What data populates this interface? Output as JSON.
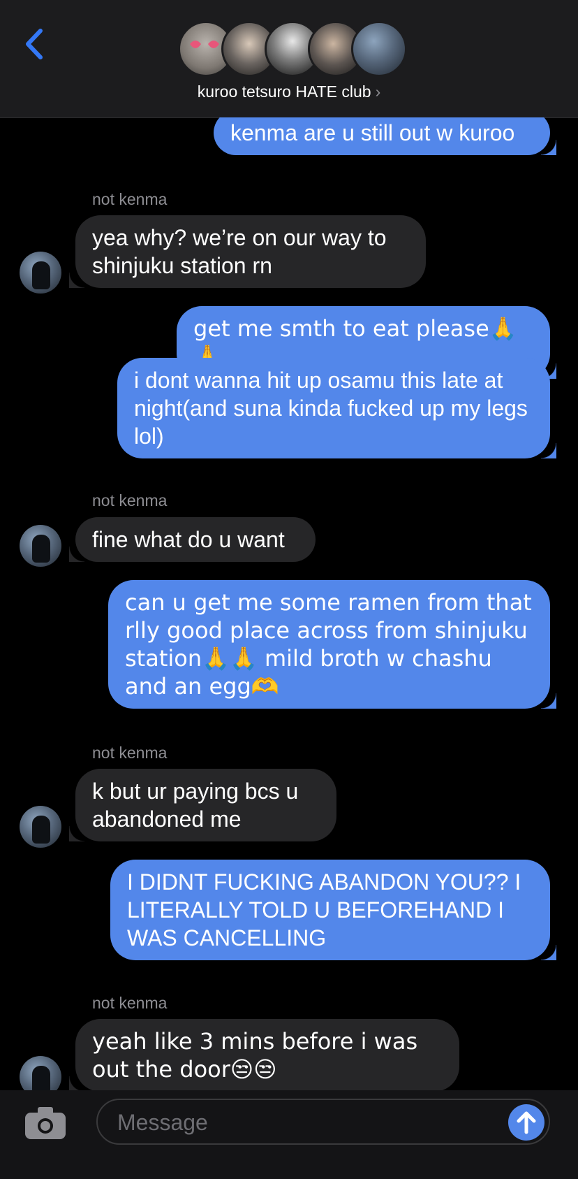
{
  "header": {
    "group_title": "kuroo tetsuro HATE club",
    "back_icon": "chevron-left-icon",
    "accent": "#3478f6"
  },
  "messages": [
    {
      "dir": "out",
      "text": "kenma are u still out w kuroo"
    },
    {
      "dir": "sender",
      "text": "not kenma"
    },
    {
      "dir": "in",
      "text": "yea why? we’re on our way to shinjuku station rn"
    },
    {
      "dir": "out",
      "text": "get me smth to eat please🙏🙏"
    },
    {
      "dir": "out",
      "text": "i dont wanna hit up osamu this late at night(and suna kinda fucked up my legs lol)"
    },
    {
      "dir": "sender",
      "text": "not kenma"
    },
    {
      "dir": "in",
      "text": "fine what do u want"
    },
    {
      "dir": "out",
      "text": "can u get me some ramen from that rlly good place across from shinjuku station🙏🙏 mild broth w chashu and an egg🫶"
    },
    {
      "dir": "sender",
      "text": "not kenma"
    },
    {
      "dir": "in",
      "text": "k but ur paying bcs u abandoned me"
    },
    {
      "dir": "out",
      "text": "I DIDNT FUCKING ABANDON YOU?? I LITERALLY TOLD U BEFOREHAND I WAS CANCELLING"
    },
    {
      "dir": "sender",
      "text": "not kenma"
    },
    {
      "dir": "in",
      "text": "yeah like 3 mins before i was out the door😒😒"
    }
  ],
  "input": {
    "placeholder": "Message",
    "camera_icon": "camera-icon",
    "send_icon": "arrow-up-icon"
  },
  "colors": {
    "outgoing_bubble": "#5387ea",
    "incoming_bubble": "#262628",
    "background": "#000000"
  }
}
